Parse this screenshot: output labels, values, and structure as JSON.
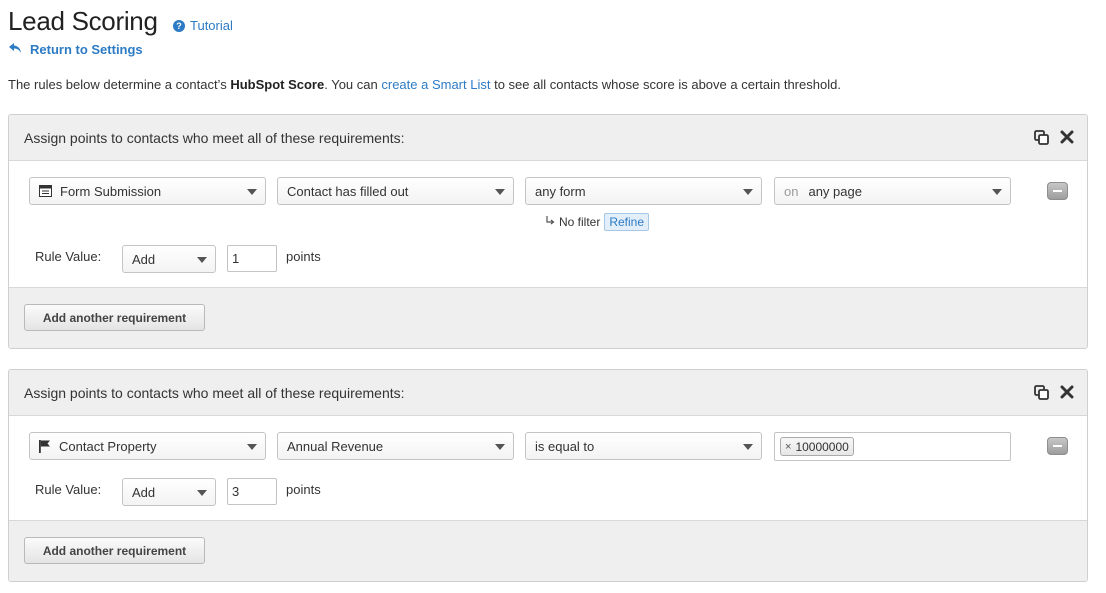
{
  "header": {
    "title": "Lead Scoring",
    "tutorial_label": "Tutorial",
    "back_label": "Return to Settings"
  },
  "intro": {
    "part1": "The rules below determine a contact’s ",
    "bold": "HubSpot Score",
    "part2": ". You can ",
    "link": "create a Smart List",
    "part3": " to see all contacts whose score is above a certain threshold."
  },
  "rules": [
    {
      "title": "Assign points to contacts who meet all of these requirements:",
      "field1": "Form Submission",
      "field1_icon": "form-icon",
      "field2": "Contact has filled out",
      "field3": "any form",
      "field4_prefix": "on",
      "field4": "any page",
      "filter_text": "No filter",
      "refine_label": "Refine",
      "rule_value_label": "Rule Value:",
      "operation": "Add",
      "points_value": "1",
      "points_label": "points",
      "add_button": "Add another requirement"
    },
    {
      "title": "Assign points to contacts who meet all of these requirements:",
      "field1": "Contact Property",
      "field1_icon": "flag-icon",
      "field2": "Annual Revenue",
      "field3": "is equal to",
      "tag_remove": "×",
      "tag_value": "10000000",
      "rule_value_label": "Rule Value:",
      "operation": "Add",
      "points_value": "3",
      "points_label": "points",
      "add_button": "Add another requirement"
    }
  ],
  "colors": {
    "link": "#2d7bc4",
    "panel_header": "#efefef",
    "border": "#cfcfcf"
  }
}
